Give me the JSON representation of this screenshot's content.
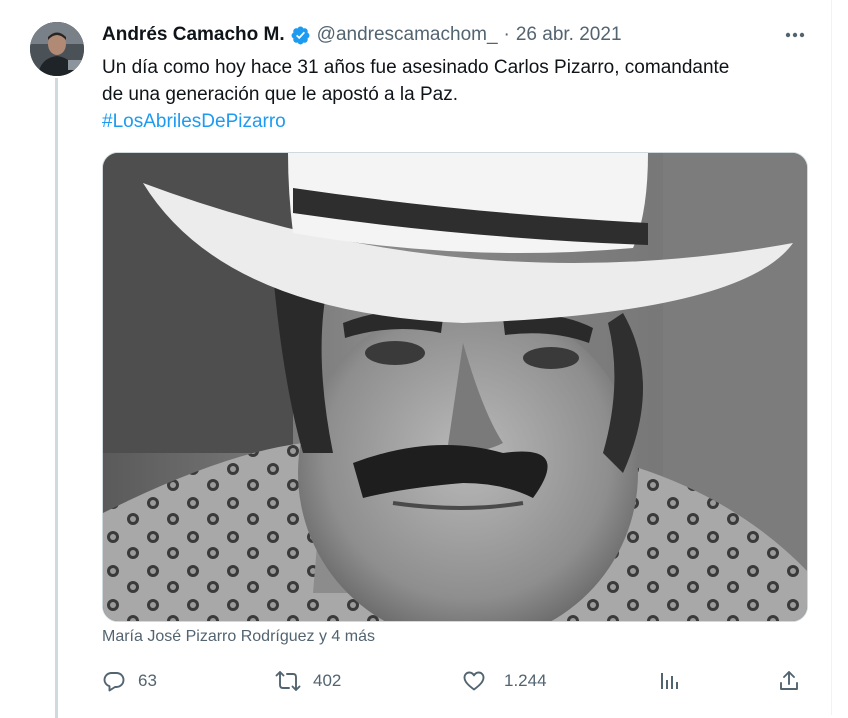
{
  "author": {
    "display_name": "Andrés Camacho M.",
    "handle": "@andrescamachom_",
    "date": "26 abr. 2021",
    "separator": "·",
    "verified_color": "#1d9bf0"
  },
  "tweet": {
    "text_line_1": "Un día como hoy hace 31 años fue asesinado Carlos Pizarro, comandante",
    "text_line_2": "de una generación que le apostó a la Paz.",
    "hashtag": "#LosAbrilesDePizarro",
    "tagged_users": "María José Pizarro Rodríguez y 4 más"
  },
  "actions": {
    "replies": "63",
    "retweets": "402",
    "likes": "1.244"
  },
  "icons": {
    "more": "more-icon",
    "verified": "verified-badge-icon",
    "reply": "reply-icon",
    "retweet": "retweet-icon",
    "like": "like-icon",
    "views": "views-icon",
    "share": "share-icon"
  },
  "colors": {
    "text": "#0f1419",
    "secondary": "#536471",
    "accent": "#1d9bf0",
    "thread_line": "#cfd9de"
  }
}
